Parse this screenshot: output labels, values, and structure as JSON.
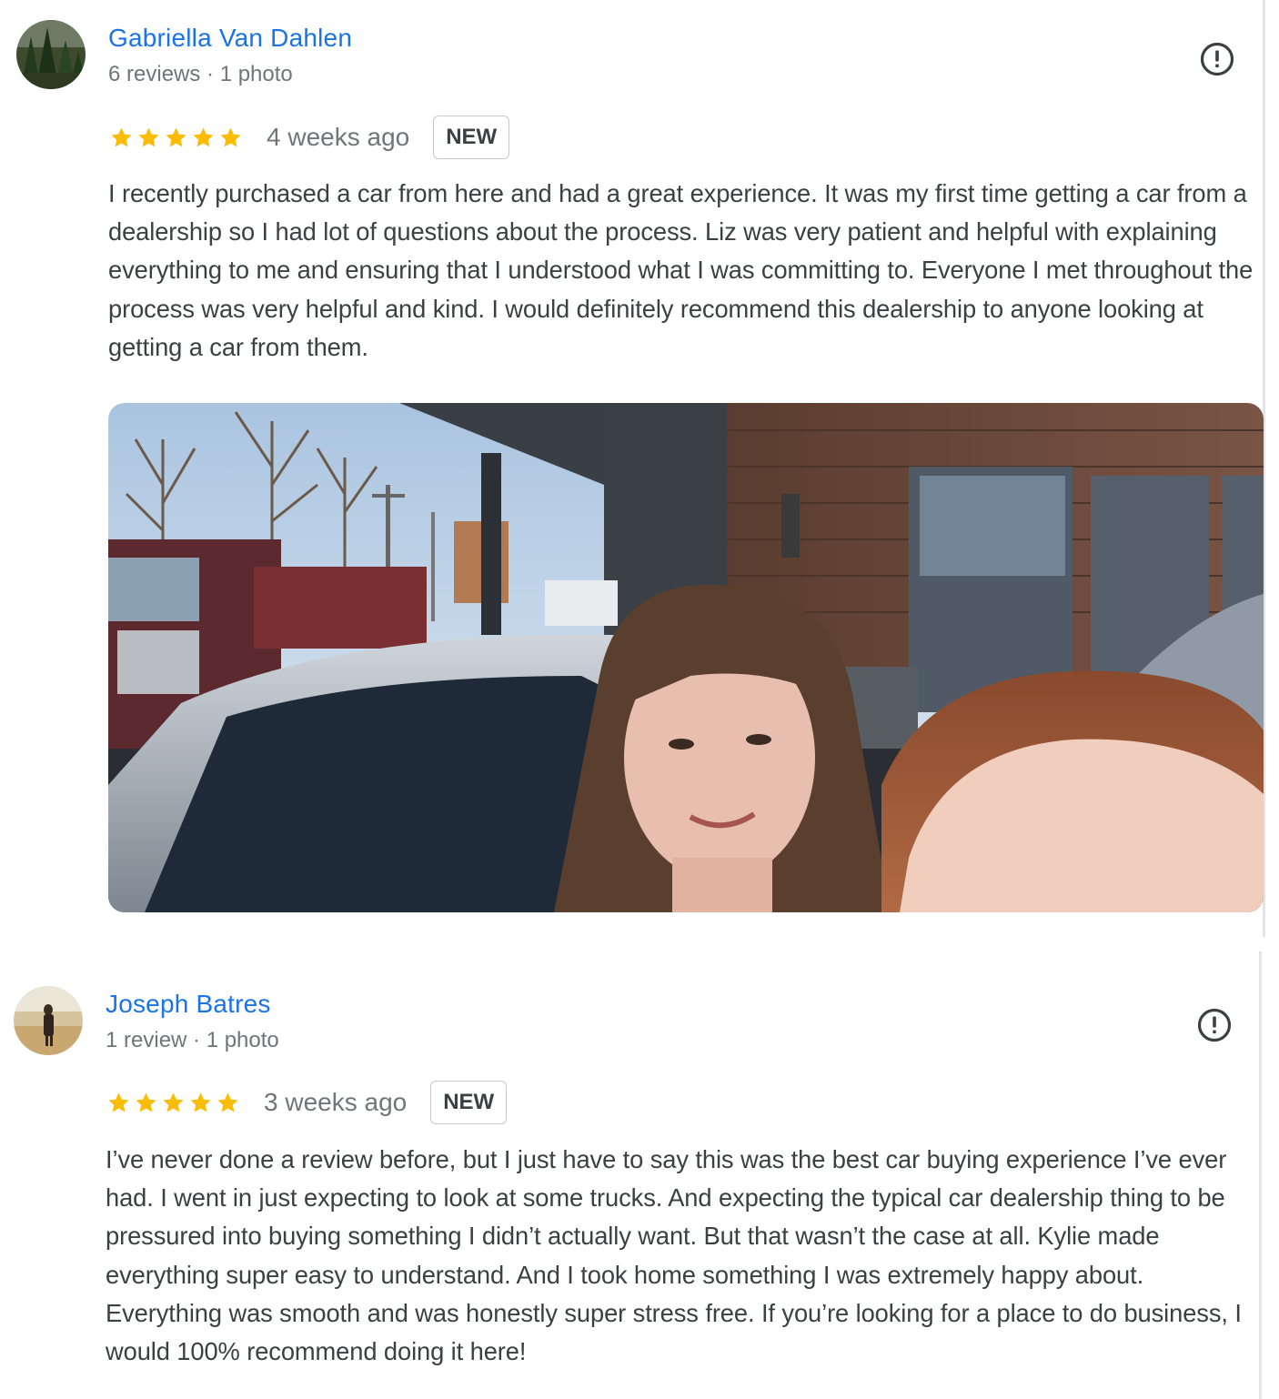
{
  "reviews": [
    {
      "author": "Gabriella Van Dahlen",
      "meta": "6 reviews · 1 photo",
      "rating": 5,
      "date": "4 weeks ago",
      "badge": "NEW",
      "text": "I recently purchased a car from here and had a great experience. It was my first time getting a car from a dealership so I had lot of questions about the process. Liz was very patient and helpful with explaining everything to me and ensuring that I understood what I was committing to. Everyone I met throughout the process was very helpful and kind. I would definitely recommend this dealership to anyone looking at getting a car from them.",
      "has_photo": true
    },
    {
      "author": "Joseph Batres",
      "meta": "1 review · 1 photo",
      "rating": 5,
      "date": "3 weeks ago",
      "badge": "NEW",
      "text": "I’ve never done a review before, but I just have to say this was the best car buying experience I’ve ever had. I went in just expecting to look at some trucks. And expecting the typical car dealership thing to be pressured into buying something I didn’t actually want. But that wasn’t the case at all. Kylie made everything super easy to understand. And I took home something I was extremely happy about. Everything was smooth and was honestly super stress free. If you’re looking for a place to do business, I would 100% recommend doing it here!",
      "has_photo": false
    }
  ],
  "colors": {
    "author_link": "#1a73e8",
    "meta_text": "#70757a",
    "body_text": "#3c4043",
    "star": "#fbbc04"
  },
  "icons": {
    "flag": "report-flag-icon",
    "star": "star-icon"
  }
}
